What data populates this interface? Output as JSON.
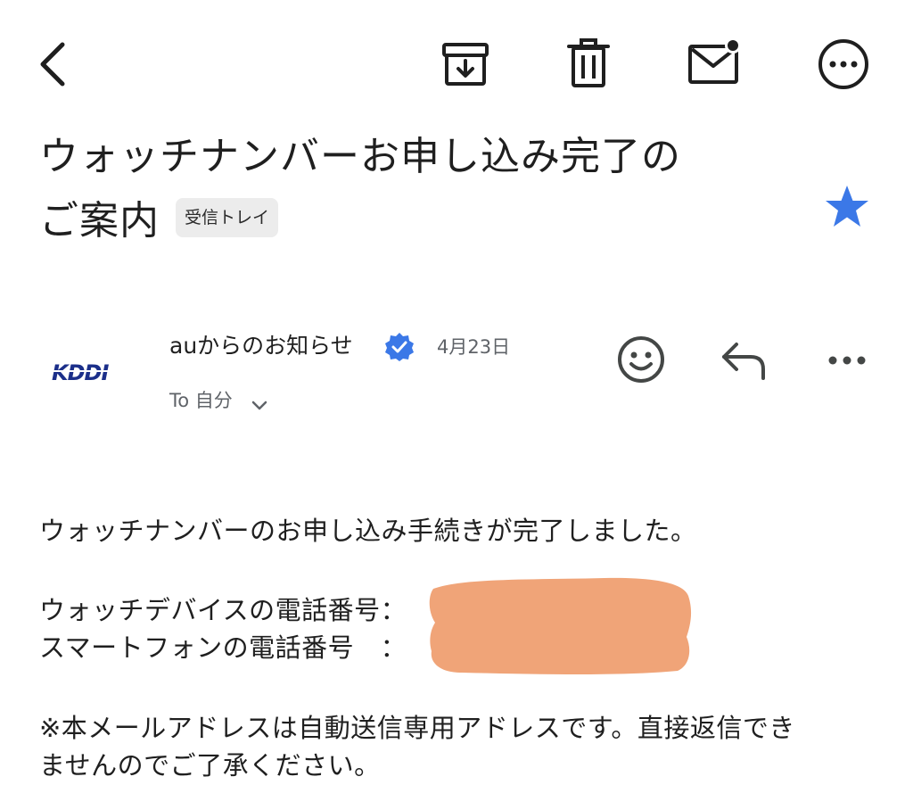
{
  "toolbar": {
    "back_icon": "chevron-left-icon",
    "archive_icon": "archive-icon",
    "delete_icon": "trash-icon",
    "mark_unread_icon": "mail-unread-icon",
    "more_icon": "more-circle-icon"
  },
  "email": {
    "subject_line1": "ウォッチナンバーお申し込み完了の",
    "subject_line2": "ご案内",
    "label": "受信トレイ",
    "starred": true,
    "star_color": "#3b78e7"
  },
  "sender": {
    "logo_text": "KDDI",
    "name": "auからのお知らせ",
    "verified": true,
    "date": "4月23日",
    "to_label": "To 自分",
    "emoji_icon": "smiley-icon",
    "reply_icon": "reply-icon",
    "more_icon": "more-horizontal-icon"
  },
  "body": {
    "line1": "ウォッチナンバーのお申し込み手続きが完了しました。",
    "watch_phone_label": "ウォッチデバイスの電話番号：",
    "smartphone_label": "スマートフォンの電話番号　：",
    "notice_line1": "※本メールアドレスは自動送信専用アドレスです。直接返信でき",
    "notice_line2": "ませんのでご了承ください。",
    "redaction_color": "#f0a478"
  }
}
